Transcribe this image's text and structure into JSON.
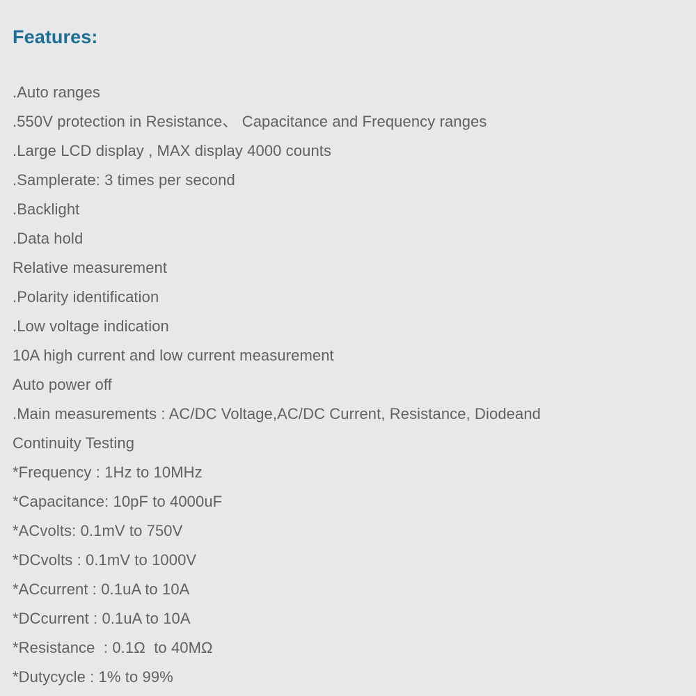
{
  "heading": {
    "text": "Features:",
    "color": "#1d6e96"
  },
  "page": {
    "background_color": "#e8e8e8",
    "text_color": "#616161"
  },
  "features": [
    {
      "text": ".Auto ranges"
    },
    {
      "text": ".550V protection in Resistance、 Capacitance and Frequency ranges"
    },
    {
      "text": ".Large LCD display , MAX display 4000 counts"
    },
    {
      "text": ".Samplerate: 3 times per second"
    },
    {
      "text": ".Backlight"
    },
    {
      "text": ".Data hold"
    },
    {
      "text": "Relative measurement"
    },
    {
      "text": ".Polarity identification"
    },
    {
      "text": ".Low voltage indication"
    },
    {
      "text": "10A high current and low current measurement"
    },
    {
      "text": "Auto power off"
    },
    {
      "text": ".Main measurements : AC/DC Voltage,AC/DC Current, Resistance, Diodeand"
    },
    {
      "text": "Continuity Testing"
    },
    {
      "text": "*Frequency : 1Hz to 10MHz"
    },
    {
      "text": "*Capacitance: 10pF to 4000uF"
    },
    {
      "text": "*ACvolts: 0.1mV to 750V"
    },
    {
      "text": "*DCvolts : 0.1mV to 1000V"
    },
    {
      "text": "*ACcurrent : 0.1uA to 10A"
    },
    {
      "text": "*DCcurrent : 0.1uA to 10A"
    },
    {
      "text": "*Resistance  : 0.1Ω  to 40MΩ"
    },
    {
      "text": "*Dutycycle : 1% to 99%"
    }
  ]
}
